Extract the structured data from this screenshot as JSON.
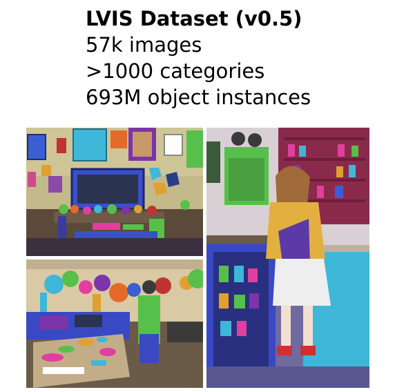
{
  "header": {
    "title": "LVIS Dataset (v0.5)",
    "stats": [
      "57k images",
      ">1000 categories",
      "693M object instances"
    ]
  },
  "images": [
    {
      "name": "living-room-annotated"
    },
    {
      "name": "kitchen-annotated"
    },
    {
      "name": "woman-in-kitchen-annotated"
    }
  ],
  "colors": {
    "wall": "#c9c08a",
    "cyan_mask": "#3fb7d8",
    "purple_mask": "#7c35a8",
    "pink_mask": "#e03fa0",
    "green_mask": "#56c04a",
    "blue_mask": "#3949c4",
    "orange_mask": "#e46a2a",
    "floor": "#6f5a45"
  }
}
